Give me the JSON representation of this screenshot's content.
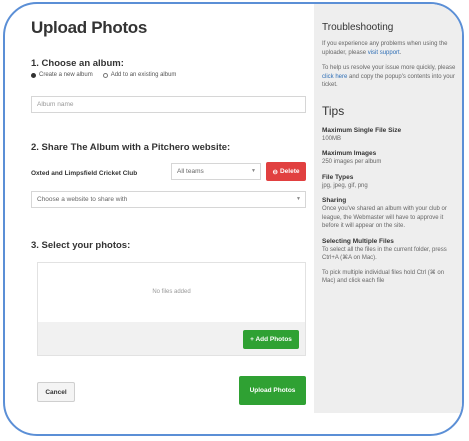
{
  "upload": {
    "title": "Upload Photos",
    "step1": {
      "heading": "1. Choose an album:",
      "radio_new": "Create a new album",
      "radio_existing": "Add to an existing album",
      "album_placeholder": "Album name"
    },
    "step2": {
      "heading": "2. Share The Album with a Pitchero website:",
      "club_name": "Oxted and Limpsfield Cricket Club",
      "teams_value": "All teams",
      "delete_label": "Delete",
      "website_value": "Choose a website to share with"
    },
    "step3": {
      "heading": "3. Select your photos:",
      "no_files": "No files added",
      "add_photos_label": "+ Add Photos"
    },
    "cancel_label": "Cancel",
    "upload_label": "Upload Photos"
  },
  "troubleshooting": {
    "title": "Troubleshooting",
    "para1_pre": "If you experience any problems when using the uploader, please ",
    "para1_link": "visit support",
    "para1_post": ".",
    "para2_pre": "To help us resolve your issue more quickly, please ",
    "para2_link": "click here",
    "para2_post": " and copy the popup's contents into your ticket."
  },
  "tips": {
    "title": "Tips",
    "max_file_size_h": "Maximum Single File Size",
    "max_file_size_v": "100MB",
    "max_images_h": "Maximum Images",
    "max_images_v": "250 images per album",
    "file_types_h": "File Types",
    "file_types_v": "jpg, jpeg, gif, png",
    "sharing_h": "Sharing",
    "sharing_v": "Once you've shared an album with your club or league, the Webmaster will have to approve it before it will appear on the site.",
    "multi_h": "Selecting Multiple Files",
    "multi_v1": "To select all the files in the current folder, press Ctrl+A (⌘A on Mac).",
    "multi_v2": "To pick multiple individual files hold Ctrl (⌘ on Mac) and click each file"
  },
  "colors": {
    "accent_green": "#2fa133",
    "delete_red": "#e14040",
    "link_blue": "#2f6fb6",
    "frame_blue": "#5b8fd6"
  }
}
